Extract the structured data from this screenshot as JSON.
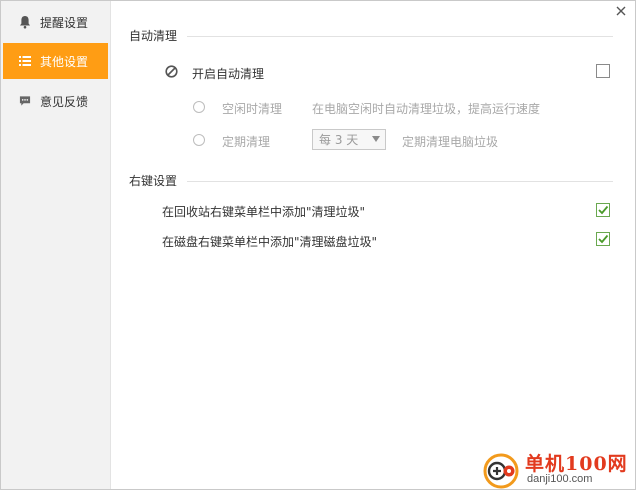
{
  "sidebar": {
    "items": [
      {
        "label": "提醒设置",
        "icon": "bell-icon",
        "active": false
      },
      {
        "label": "其他设置",
        "icon": "list-icon",
        "active": true
      },
      {
        "label": "意见反馈",
        "icon": "chat-icon",
        "active": false
      }
    ]
  },
  "auto_clean": {
    "section_title": "自动清理",
    "enable_label": "开启自动清理",
    "enable_checked": false,
    "idle_option": {
      "label": "空闲时清理",
      "description": "在电脑空闲时自动清理垃圾，提高运行速度"
    },
    "scheduled_option": {
      "label": "定期清理",
      "interval_value": "每 3 天",
      "description": "定期清理电脑垃圾"
    }
  },
  "context_menu": {
    "section_title": "右键设置",
    "options": [
      {
        "label": "在回收站右键菜单栏中添加\"清理垃圾\"",
        "checked": true
      },
      {
        "label": "在磁盘右键菜单栏中添加\"清理磁盘垃圾\"",
        "checked": true
      }
    ]
  },
  "watermark": {
    "title": "单机100网",
    "url": "danji100.com"
  },
  "colors": {
    "accent": "#ff9d14",
    "check": "#4a9a2a",
    "muted_text": "#a8a8a8"
  }
}
